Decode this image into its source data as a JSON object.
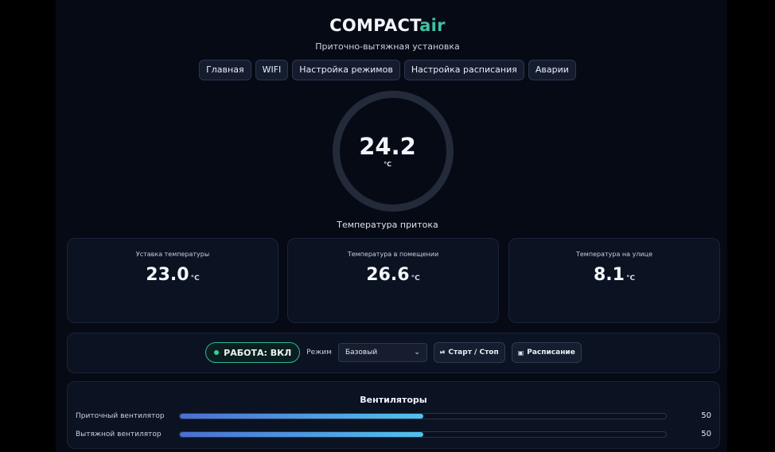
{
  "header": {
    "brand_main": "COMPACT",
    "brand_accent": "air",
    "subtitle": "Приточно-вытяжная установка"
  },
  "nav": {
    "items": [
      {
        "label": "Главная"
      },
      {
        "label": "WIFI"
      },
      {
        "label": "Настройка режимов"
      },
      {
        "label": "Настройка расписания"
      },
      {
        "label": "Аварии"
      }
    ]
  },
  "gauge": {
    "value": "24.2",
    "unit": "°C",
    "label": "Температура притока"
  },
  "cards": [
    {
      "label": "Уставка температуры",
      "value": "23.0",
      "unit": "°C"
    },
    {
      "label": "Температура в помещении",
      "value": "26.6",
      "unit": "°C"
    },
    {
      "label": "Температура на улице",
      "value": "8.1",
      "unit": "°C"
    }
  ],
  "controls": {
    "status": "РАБОТА: ВКЛ",
    "mode_label": "Режим",
    "mode_value": "Базовый",
    "start_stop_label": "Старт / Стоп",
    "schedule_label": "Расписание"
  },
  "fans": {
    "title": "Вентиляторы",
    "items": [
      {
        "label": "Приточный вентилятор",
        "value": "50",
        "percent": 50
      },
      {
        "label": "Вытяжной вентилятор",
        "value": "50",
        "percent": 50
      }
    ]
  },
  "colors": {
    "accent": "#3fc1a6",
    "status_green": "#35d29b",
    "fan_gradient_start": "#4a6fd3",
    "fan_gradient_end": "#4fc3ee"
  }
}
